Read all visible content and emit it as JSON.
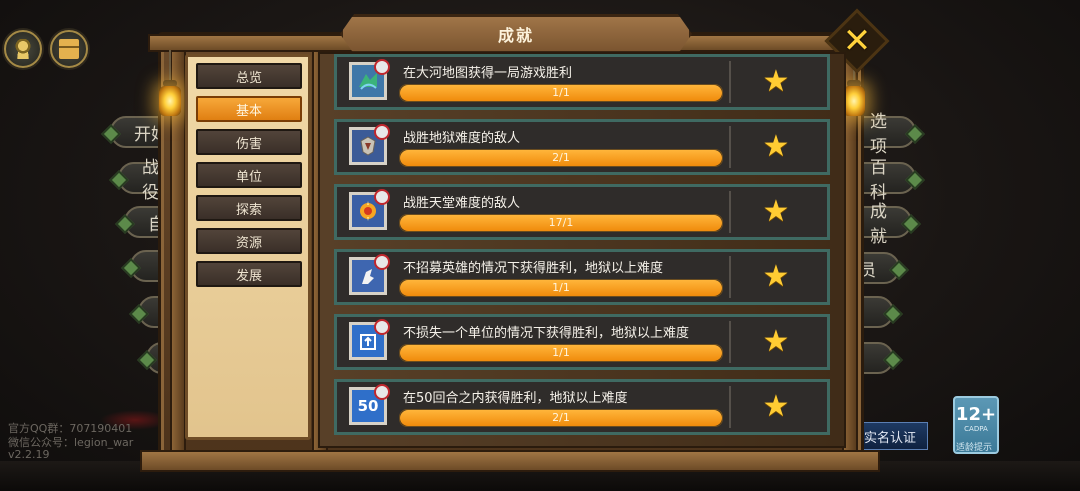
{
  "panel": {
    "title": "成就"
  },
  "categories": [
    {
      "label": "总览",
      "active": false
    },
    {
      "label": "基本",
      "active": true
    },
    {
      "label": "伤害",
      "active": false
    },
    {
      "label": "单位",
      "active": false
    },
    {
      "label": "探索",
      "active": false
    },
    {
      "label": "资源",
      "active": false
    },
    {
      "label": "发展",
      "active": false
    }
  ],
  "achievements": [
    {
      "title": "在大河地图获得一局游戏胜利",
      "progress": "1/1",
      "fill": 1.0,
      "icon": "map-icon"
    },
    {
      "title": "战胜地狱难度的敌人",
      "progress": "2/1",
      "fill": 1.0,
      "icon": "hell-crest-icon"
    },
    {
      "title": "战胜天堂难度的敌人",
      "progress": "17/1",
      "fill": 1.0,
      "icon": "heaven-crest-icon"
    },
    {
      "title": "不招募英雄的情况下获得胜利，地狱以上难度",
      "progress": "1/1",
      "fill": 1.0,
      "icon": "no-hero-icon"
    },
    {
      "title": "不损失一个单位的情况下获得胜利，地狱以上难度",
      "progress": "1/1",
      "fill": 1.0,
      "icon": "no-loss-icon"
    },
    {
      "title": "在50回合之内获得胜利，地狱以上难度",
      "progress": "2/1",
      "fill": 1.0,
      "icon": "turn-50-icon",
      "icon_text": "50"
    }
  ],
  "background_menu": {
    "left": [
      "开始",
      "战役",
      "自",
      "",
      "",
      ""
    ],
    "right": [
      "选项",
      "百科",
      "成就",
      "员",
      "",
      ""
    ]
  },
  "footer": {
    "qq": "官方QQ群：707190401",
    "wechat": "微信公众号：legion_war",
    "version": "v2.2.19"
  },
  "realname_label": "实名认证",
  "age_rating": {
    "label": "12+",
    "org": "CADPA",
    "caption": "适龄提示"
  },
  "colors": {
    "accent": "#f08b0c",
    "row_border": "#3f6a62",
    "star": "#ffcc33"
  }
}
